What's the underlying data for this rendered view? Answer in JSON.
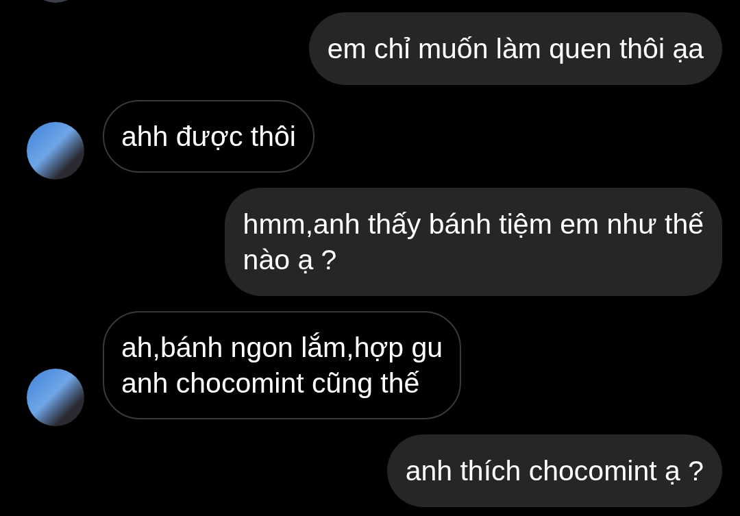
{
  "messages": [
    {
      "kind": "outgoing",
      "text": "em chỉ muốn làm quen thôi ạa"
    },
    {
      "kind": "incoming",
      "text": "ahh được thôi"
    },
    {
      "kind": "outgoing",
      "text": "hmm,anh thấy bánh tiệm em như thế\nnào ạ ?"
    },
    {
      "kind": "incoming",
      "text": "ah,bánh ngon lắm,hợp gu\nanh chocomint cũng thế"
    },
    {
      "kind": "outgoing",
      "text": "anh thích chocomint ạ ?"
    }
  ]
}
